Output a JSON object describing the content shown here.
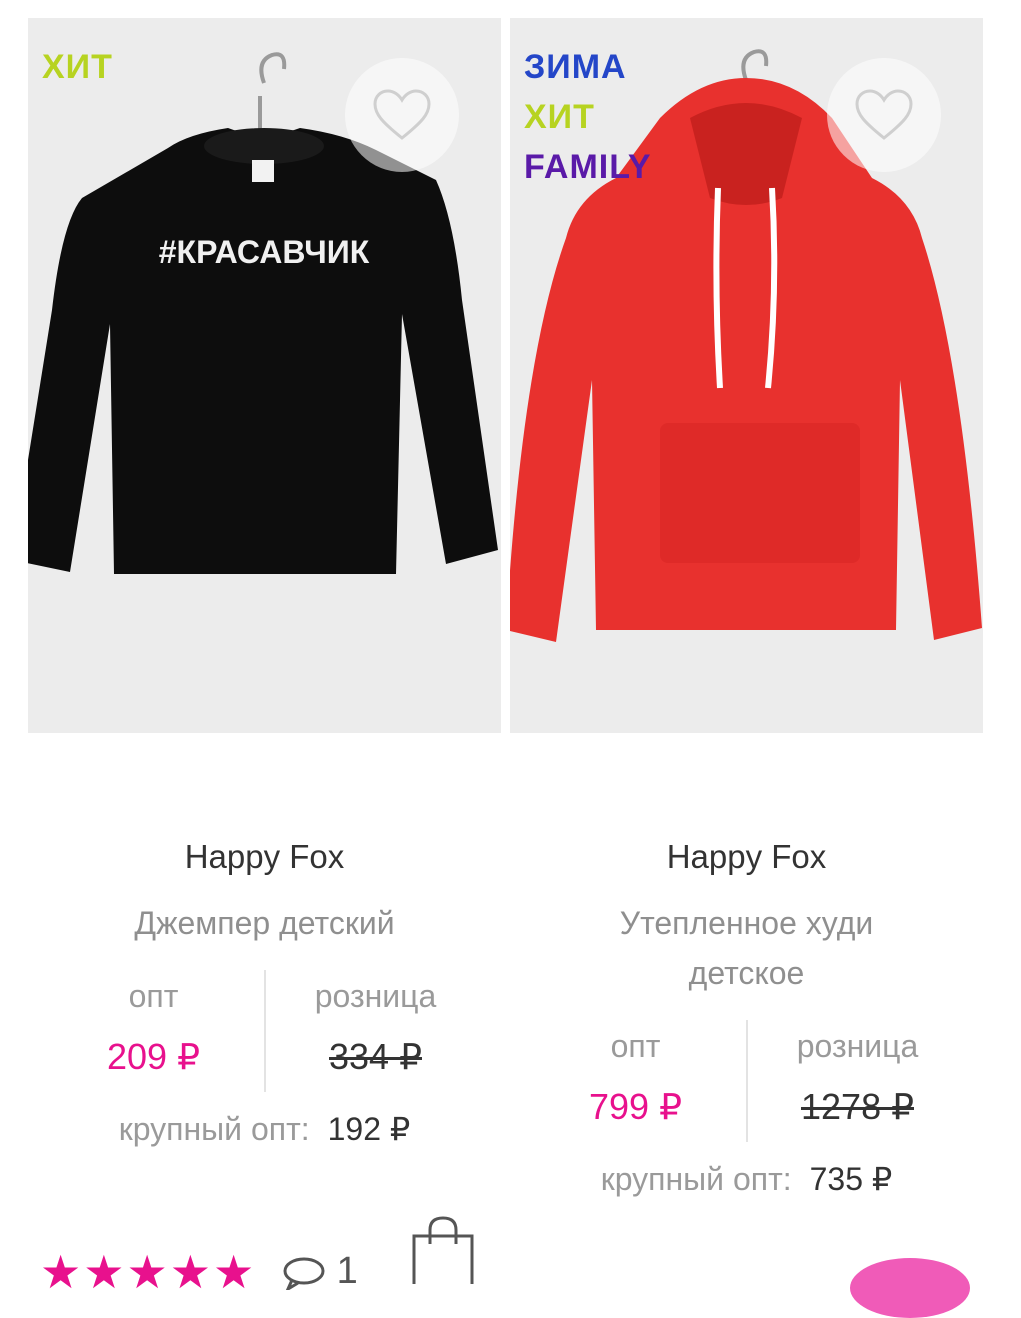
{
  "products": [
    {
      "badges": [
        {
          "text": "ХИТ",
          "color": "#b7d321"
        }
      ],
      "print_text": "#КРАСАВЧИК",
      "brand": "Happy Fox",
      "name": "Джемпер детский",
      "opt_label": "опт",
      "retail_label": "розница",
      "opt_price": "209 ₽",
      "retail_price": "334 ₽",
      "bulk_label": "крупный опт:",
      "bulk_price": "192 ₽",
      "rating_stars": "★★★★★",
      "comments_count": "1"
    },
    {
      "badges": [
        {
          "text": "ЗИМА",
          "color": "#2446c8"
        },
        {
          "text": "ХИТ",
          "color": "#b7d321"
        },
        {
          "text": "FAMILY",
          "color": "#5a1aa8"
        }
      ],
      "brand": "Happy Fox",
      "name": "Утепленное худи детское",
      "opt_label": "опт",
      "retail_label": "розница",
      "opt_price": "799 ₽",
      "retail_price": "1278 ₽",
      "bulk_label": "крупный опт:",
      "bulk_price": "735 ₽"
    }
  ],
  "colors": {
    "accent": "#e8118d",
    "photo_bg": "#ececec"
  },
  "icons": {
    "favorite": "heart-outline-icon",
    "comment": "speech-bubble-icon",
    "cart": "shopping-bag-icon"
  }
}
